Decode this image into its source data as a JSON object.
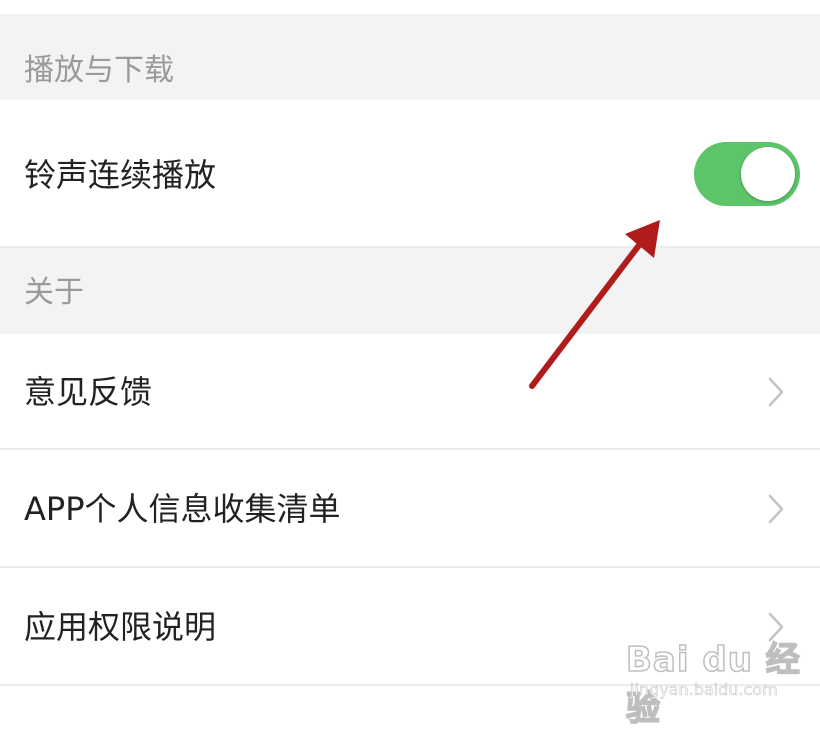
{
  "sections": [
    {
      "title": "播放与下载"
    },
    {
      "title": "关于"
    }
  ],
  "rows": {
    "ringtone": {
      "label": "铃声连续播放",
      "toggle_on": true
    },
    "feedback": {
      "label": "意见反馈"
    },
    "info_list": {
      "label": "APP个人信息收集清单"
    },
    "permissions": {
      "label": "应用权限说明"
    }
  },
  "colors": {
    "toggle_on": "#5ec46a",
    "section_bg": "#f3f3f3",
    "annotation_arrow": "#b01c1c"
  },
  "watermark": {
    "brand": "Bai du 经验",
    "site": "jingyan.baidu.com"
  }
}
